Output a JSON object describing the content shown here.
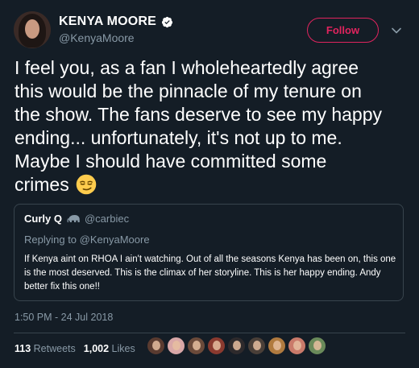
{
  "author": {
    "display_name": "KENYA MOORE",
    "handle": "@KenyaMoore",
    "verified": true,
    "avatar_icon": "avatar"
  },
  "follow_label": "Follow",
  "more_icon": "chevron-down-icon",
  "tweet_text": "I feel you, as a fan I wholeheartedly agree\nthis would be the pinnacle of my tenure on\nthe show. The fans deserve to see my happy\nending... unfortunately, it's not up to me.\nMaybe I should have committed some\ncrimes",
  "emoji": "smirking-face",
  "quoted": {
    "name": "Curly Q",
    "name_icon": "elephant-icon",
    "handle": "@carbiec",
    "reply_to": "Replying to @KenyaMoore",
    "text": "If Kenya aint on RHOA I ain't watching. Out of all the seasons Kenya has been on, this one is the most deserved. This is the climax of her storyline. This is her happy ending. Andy better fix this one!!"
  },
  "timestamp": "1:50 PM - 24 Jul 2018",
  "stats": {
    "retweets_count": "113",
    "retweets_label": "Retweets",
    "likes_count": "1,002",
    "likes_label": "Likes"
  },
  "likers_colors": [
    "#5a3b30",
    "#d9a7a7",
    "#6b4a3a",
    "#8a3a2f",
    "#2e2a2c",
    "#4a3f38",
    "#b07a3f",
    "#c97a6a",
    "#6a8a5a"
  ],
  "colors": {
    "background": "#141d26",
    "accent": "#e0245e",
    "muted": "#8899a6",
    "verified": "#ffffff"
  }
}
